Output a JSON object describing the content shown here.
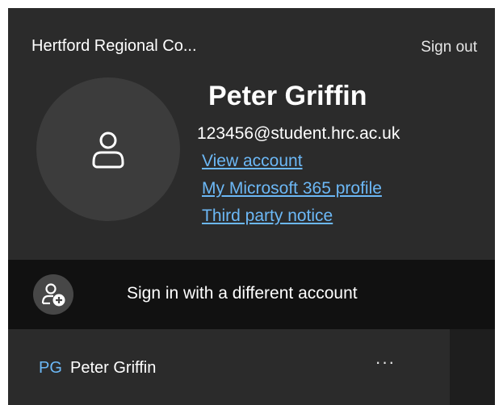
{
  "header": {
    "org_name": "Hertford Regional Co...",
    "sign_out": "Sign out"
  },
  "profile": {
    "avatar_icon": "person-icon",
    "name": "Peter Griffin",
    "email": "123456@student.hrc.ac.uk",
    "links": [
      "View account",
      "My Microsoft 365 profile",
      "Third party notice"
    ]
  },
  "other_account": {
    "icon": "person-add-icon",
    "label": "Sign in with a different account"
  },
  "accounts": [
    {
      "initials": "PG",
      "name": "Peter Griffin",
      "more": "···"
    }
  ],
  "colors": {
    "panel_bg": "#2b2b2b",
    "dark_row_bg": "#111111",
    "link": "#6cb8f6",
    "text": "#ffffff"
  }
}
